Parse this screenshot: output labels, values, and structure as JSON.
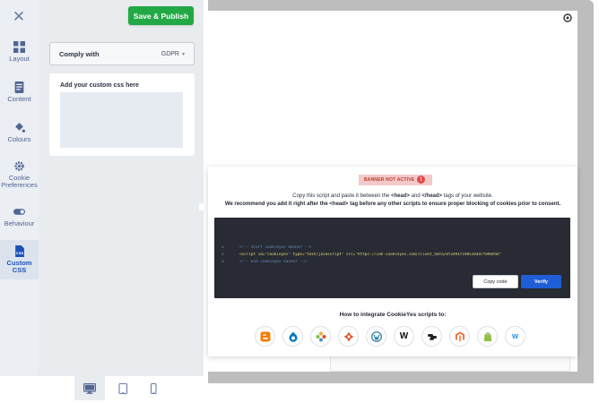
{
  "editor": {
    "close_icon": "close-icon",
    "save_label": "Save & Publish",
    "save_color": "#22a845",
    "nav": [
      {
        "id": "layout",
        "label": "Layout",
        "icon": "layout-grid-icon",
        "active": false
      },
      {
        "id": "content",
        "label": "Content",
        "icon": "document-icon",
        "active": false
      },
      {
        "id": "colours",
        "label": "Colours",
        "icon": "paint-bucket-icon",
        "active": false
      },
      {
        "id": "cookie-preferences",
        "label": "Cookie Preferences",
        "icon": "gear-icon",
        "active": false
      },
      {
        "id": "behaviour",
        "label": "Behaviour",
        "icon": "toggle-icon",
        "active": false
      },
      {
        "id": "custom-css",
        "label": "Custom CSS",
        "icon": "css-file-icon",
        "active": true
      }
    ],
    "comply": {
      "label": "Comply with",
      "value": "GDPR"
    },
    "custom_css": {
      "title": "Add your custom css here",
      "value": ""
    },
    "devices": [
      {
        "id": "desktop",
        "icon": "desktop-icon",
        "active": true
      },
      {
        "id": "tablet",
        "icon": "tablet-icon",
        "active": false
      },
      {
        "id": "mobile",
        "icon": "mobile-icon",
        "active": false
      }
    ]
  },
  "preview": {
    "status_badge": "BANNER NOT ACTIVE",
    "instructions": {
      "line1_before": "Copy this script and paste it between the ",
      "line1_head": "<head>",
      "line1_mid": " and ",
      "line1_endhead": "</head>",
      "line1_after": " tags of your website.",
      "line2_before": "We recommend you add it right after the ",
      "line2_head": "<head>",
      "line2_after": " tag before any other scripts to ensure proper blocking of cookies prior to consent."
    },
    "code_lines": [
      {
        "n": "1",
        "text": "<!-- Start cookieyes banner -->"
      },
      {
        "n": "2",
        "text": "<script id=\"cookieyes\" type=\"text/javascript\" src=\"https://cdn-cookieyes.com/client_data/0f2d91f19852b4d7f09095b\""
      },
      {
        "n": "3",
        "text": "<!-- End cookieyes banner -->"
      }
    ],
    "copy_label": "Copy code",
    "verify_label": "Verify",
    "verify_color": "#1f5ed6",
    "integrate_title": "How to integrate CookieYes scripts to:",
    "platforms": [
      {
        "id": "blogger",
        "icon": "blogger-icon",
        "color": "#f57d00"
      },
      {
        "id": "drupal",
        "icon": "drupal-icon",
        "color": "#0678be"
      },
      {
        "id": "joomla",
        "icon": "joomla-icon",
        "color": "#e44d26"
      },
      {
        "id": "html5",
        "icon": "html5-icon",
        "color": "#e34f26"
      },
      {
        "id": "wordpress",
        "icon": "wordpress-icon",
        "color": "#21759b"
      },
      {
        "id": "wix",
        "icon": "wix-icon",
        "color": "#111111"
      },
      {
        "id": "squarespace",
        "icon": "squarespace-icon",
        "color": "#222222"
      },
      {
        "id": "magento",
        "icon": "magento-icon",
        "color": "#ee672f"
      },
      {
        "id": "shopify",
        "icon": "shopify-icon",
        "color": "#95bf47"
      },
      {
        "id": "weebly",
        "icon": "weebly-icon",
        "color": "#2990ea"
      }
    ]
  }
}
